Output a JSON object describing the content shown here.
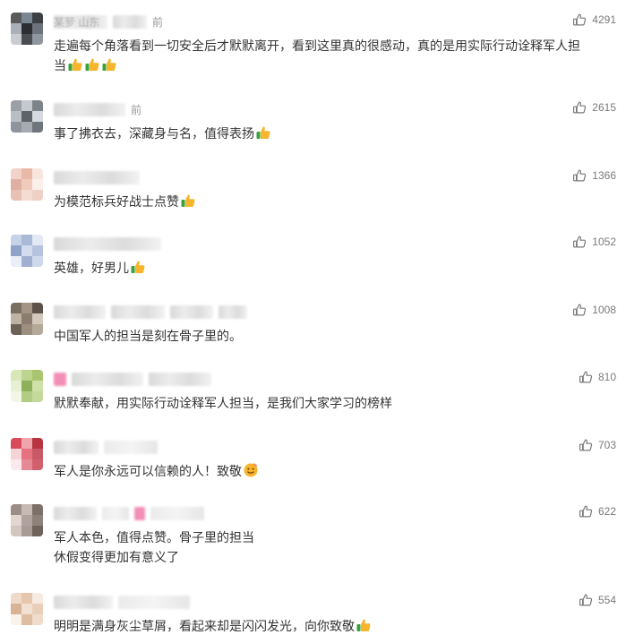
{
  "comments": [
    {
      "name": "某萝 山东",
      "time": "前",
      "likes": "4291",
      "lines": [
        "走遍每个角落看到一切安全后才默默离开，看到这里真的很感动，真的是用实际行动诠释军人担",
        "当"
      ],
      "emojis": [
        "thumbs-up-icon",
        "thumbs-up-icon",
        "thumbs-up-icon"
      ]
    },
    {
      "name": "",
      "time": "前",
      "likes": "2615",
      "lines": [
        "事了拂衣去，深藏身与名，值得表扬"
      ],
      "emojis": [
        "thumbs-up-icon"
      ]
    },
    {
      "name": "",
      "time": "",
      "likes": "1366",
      "lines": [
        "为模范标兵好战士点赞"
      ],
      "emojis": [
        "thumbs-up-icon"
      ]
    },
    {
      "name": "",
      "time": "",
      "likes": "1052",
      "lines": [
        "英雄，好男儿"
      ],
      "emojis": [
        "thumbs-up-icon"
      ]
    },
    {
      "name": "",
      "time": "",
      "likes": "1008",
      "lines": [
        "中国军人的担当是刻在骨子里的。"
      ],
      "emojis": []
    },
    {
      "name": "",
      "time": "",
      "likes": "810",
      "lines": [
        "默默奉献，用实际行动诠释军人担当，是我们大家学习的榜样"
      ],
      "emojis": []
    },
    {
      "name": "",
      "time": "",
      "likes": "703",
      "lines": [
        "军人是你永远可以信赖的人！致敬"
      ],
      "emojis": [
        "salute-face-icon"
      ]
    },
    {
      "name": "",
      "time": "",
      "likes": "622",
      "lines": [
        "军人本色，值得点赞。骨子里的担当",
        "休假变得更加有意义了"
      ],
      "emojis": []
    },
    {
      "name": "",
      "time": "",
      "likes": "554",
      "lines": [
        "明明是满身灰尘草屑，看起来却是闪闪发光，向你致敬"
      ],
      "emojis": [
        "thumbs-up-icon"
      ]
    }
  ],
  "colors": {
    "text": "#333333",
    "meta": "#999999",
    "like_count": "#7a7a7a",
    "emoji_yellow": "#f7b52c",
    "emoji_green": "#3aa23a"
  }
}
